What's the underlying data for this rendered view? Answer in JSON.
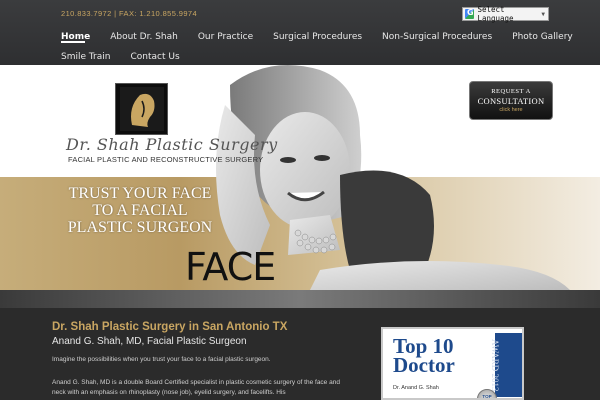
{
  "header": {
    "phone": "210.833.7972  |  FAX: 1.210.855.9974",
    "language_select": "Select Language",
    "language_arrow": "▼"
  },
  "nav": {
    "items": [
      {
        "label": "Home",
        "active": true
      },
      {
        "label": "About Dr. Shah"
      },
      {
        "label": "Our Practice"
      },
      {
        "label": "Surgical Procedures"
      },
      {
        "label": "Non-Surgical Procedures"
      },
      {
        "label": "Photo Gallery"
      },
      {
        "label": "Smile Train"
      },
      {
        "label": "Contact Us"
      }
    ]
  },
  "hero": {
    "logo_script": "Dr. Shah Plastic Surgery",
    "logo_sub": "FACIAL PLASTIC AND RECONSTRUCTIVE SURGERY",
    "tagline_line1": "TRUST YOUR FACE",
    "tagline_line2": "TO A FACIAL",
    "tagline_line3": "PLASTIC SURGEON",
    "face_word": "FACE",
    "consult": {
      "line1": "REQUEST A",
      "line2": "CONSULTATION",
      "line3": "click here"
    }
  },
  "content": {
    "title": "Dr. Shah Plastic Surgery in San Antonio TX",
    "subtitle": "Anand G. Shah, MD, Facial Plastic Surgeon",
    "intro": "Imagine the possibilities when you trust your face to a facial plastic surgeon.",
    "paragraph": "Anand G. Shah, MD is a double Board Certified specialist in plastic cosmetic surgery of the face and neck with an emphasis on rhinoplasty (nose job), eyelid surgery, and facelifts. His",
    "award": {
      "headline_1": "Top 10",
      "headline_2": "Doctor",
      "side": "AWARD 2013",
      "name": "Dr. Anand G. Shah",
      "badge": "TOP"
    }
  },
  "colors": {
    "accent_gold": "#c9a662",
    "header_dark": "#3b3c3e",
    "award_blue": "#1e4a8c"
  }
}
